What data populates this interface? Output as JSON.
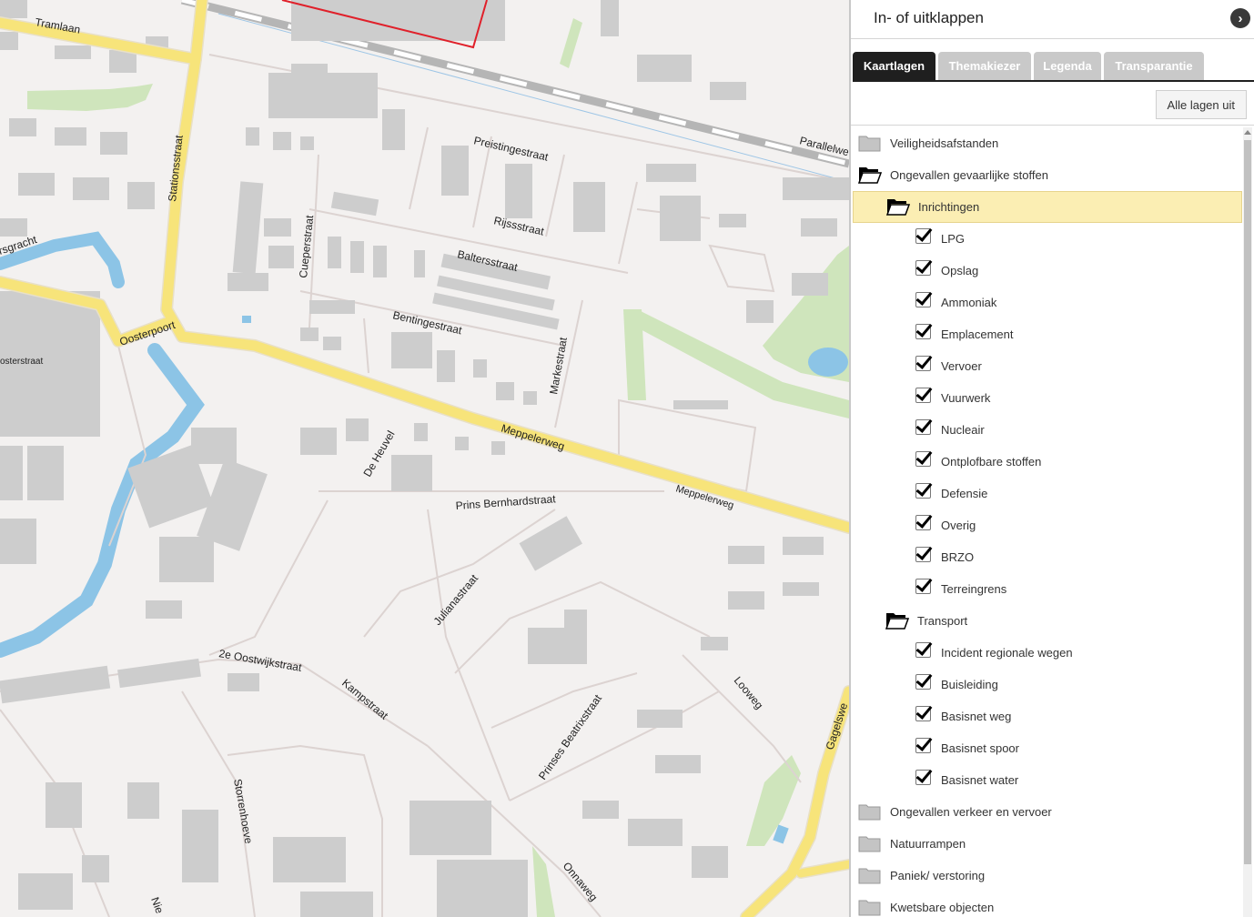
{
  "map": {
    "streets": {
      "tramlaan": "Tramlaan",
      "stationsstraat": "Stationsstraat",
      "preistingestraat": "Preistingestraat",
      "parallelweg": "Parallelwe",
      "rijssstraat": "Rijssstraat",
      "cueperstraat": "Cueperstraat",
      "baltersstraat": "Baltersstraat",
      "gracht": "rsgracht",
      "bentingestraat": "Bentingestraat",
      "oosterpoort": "Oosterpoort",
      "oosterstraat": "osterstraat",
      "markestraat": "Markestraat",
      "meppelerweg1": "Meppelerweg",
      "meppelerweg2": "Meppelerweg",
      "deheuvel": "De Heuvel",
      "prinsbernhard": "Prins Bernhardstraat",
      "julianastraat": "Julianastraat",
      "oostwijkstraat": "2e Oostwijkstraat",
      "kampstraat": "Kampstraat",
      "looweg": "Looweg",
      "prinsesbeatrix": "Prinses Beatrixstraat",
      "gagelsweg": "Gagelswe",
      "storrenhoeve": "Storrenhoeve",
      "onnaweg": "Onnaweg",
      "nie": "Nie"
    }
  },
  "panel": {
    "title": "In- of uitklappen",
    "toggle_icon": "›",
    "tabs": [
      "Kaartlagen",
      "Themakiezer",
      "Legenda",
      "Transparantie"
    ],
    "all_off_label": "Alle lagen uit",
    "tree": {
      "veiligheid": "Veiligheidsafstanden",
      "ongevallen_gs": "Ongevallen gevaarlijke stoffen",
      "inrichtingen": "Inrichtingen",
      "inrichtingen_items": [
        "LPG",
        "Opslag",
        "Ammoniak",
        "Emplacement",
        "Vervoer",
        "Vuurwerk",
        "Nucleair",
        "Ontplofbare stoffen",
        "Defensie",
        "Overig",
        "BRZO",
        "Terreingrens"
      ],
      "transport": "Transport",
      "transport_items": [
        "Incident regionale wegen",
        "Buisleiding",
        "Basisnet weg",
        "Basisnet spoor",
        "Basisnet water"
      ],
      "verkeer": "Ongevallen verkeer en vervoer",
      "natuurrampen": "Natuurrampen",
      "paniek": "Paniek/ verstoring",
      "kwetsbare": "Kwetsbare objecten"
    }
  },
  "colors": {
    "road_major": "#f7e47a",
    "water": "#8cc4e6",
    "green": "#c9e3b3",
    "building": "#cdcdcd",
    "selected_row": "#fbeeb3"
  }
}
